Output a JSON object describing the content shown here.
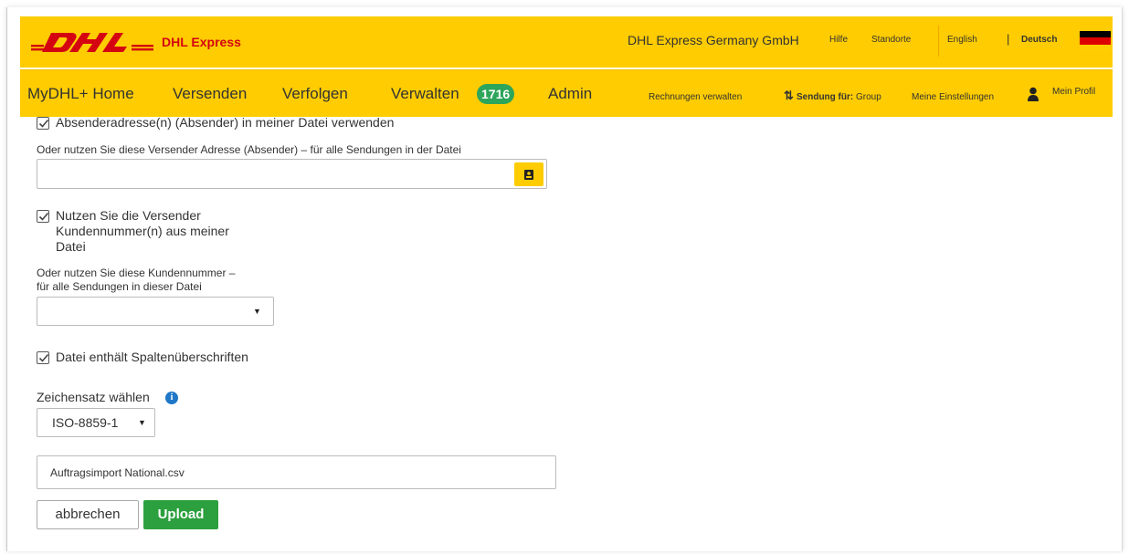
{
  "header": {
    "brand_product": "DHL Express",
    "company": "DHL Express Germany GmbH",
    "links": {
      "help": "Hilfe",
      "locations": "Standorte",
      "english": "English",
      "separator": "|",
      "deutsch": "Deutsch"
    },
    "colors": {
      "dhl_yellow": "#fecc00",
      "dhl_red": "#d40511"
    }
  },
  "nav": {
    "home": "MyDHL+ Home",
    "send": "Versenden",
    "track": "Verfolgen",
    "manage": "Verwalten",
    "manage_badge": "1716",
    "admin": "Admin",
    "invoices": "Rechnungen verwalten",
    "ship_for_label": "Sendung für:",
    "ship_for_value": "Group",
    "settings": "Meine Einstellungen",
    "profile": "Mein Profil"
  },
  "form": {
    "use_sender_address_label": "Absenderadresse(n) (Absender) in meiner Datei verwenden",
    "use_sender_address_checked": true,
    "alt_sender_address_label": "Oder nutzen Sie diese  Versender Adresse (Absender) – für alle Sendungen in der Datei",
    "alt_sender_address_value": "",
    "use_customer_numbers_label_1": "Nutzen Sie die Versender",
    "use_customer_numbers_label_2": "Kundennummer(n) aus meiner",
    "use_customer_numbers_label_3": "Datei",
    "use_customer_numbers_checked": true,
    "alt_customer_number_label_1": "Oder nutzen Sie diese Kundennummer –",
    "alt_customer_number_label_2": "für alle Sendungen in dieser Datei",
    "alt_customer_number_value": "",
    "has_headers_label": "Datei enthält Spaltenüberschriften",
    "has_headers_checked": true,
    "charset_label": "Zeichensatz wählen",
    "charset_value": "ISO-8859-1",
    "file_name": "Auftragsimport National.csv",
    "cancel_label": "abbrechen",
    "upload_label": "Upload"
  }
}
